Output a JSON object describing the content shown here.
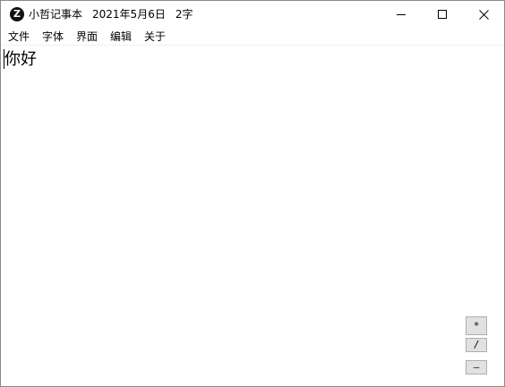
{
  "app": {
    "icon_letter": "Z",
    "title": "小哲记事本",
    "date": "2021年5月6日",
    "char_count": "2字"
  },
  "window_controls": {
    "minimize_icon": "minimize-icon",
    "maximize_icon": "maximize-icon",
    "close_icon": "close-icon"
  },
  "menu": {
    "items": [
      {
        "label": "文件"
      },
      {
        "label": "字体"
      },
      {
        "label": "界面"
      },
      {
        "label": "编辑"
      },
      {
        "label": "关于"
      }
    ]
  },
  "editor": {
    "content": "你好"
  },
  "side_buttons": {
    "multiply": "*",
    "divide": "/",
    "minus": "–"
  }
}
